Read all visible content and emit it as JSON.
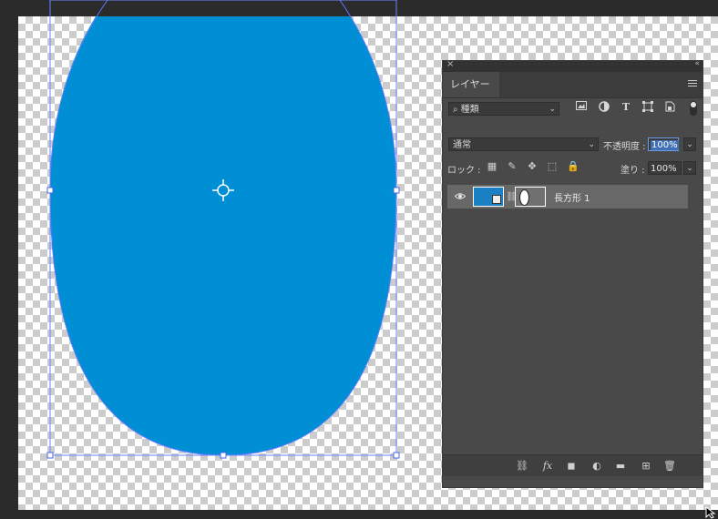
{
  "panel": {
    "tab_label": "レイヤー",
    "filter": {
      "glass": "⌕",
      "value": "種類",
      "chevron": "⌄"
    },
    "filter_icons": [
      "image-filter-icon",
      "adjustment-filter-icon",
      "type-filter-icon",
      "shape-filter-icon",
      "smart-object-filter-icon"
    ],
    "blend_mode": "通常",
    "opacity_label": "不透明度 :",
    "opacity_value": "100%",
    "lock_label": "ロック :",
    "fill_label": "塗り :",
    "fill_value": "100%",
    "layers": [
      {
        "name": "長方形 1",
        "visible": true,
        "fill_color": "#1b7fc4"
      }
    ]
  },
  "canvas": {
    "shape_color": "#008fd5",
    "guide_color": "#5a7bff"
  },
  "glyphs": {
    "close": "×",
    "collapse": "«",
    "eye": "👁",
    "chain": "⛓",
    "dropdown": "⌄",
    "lock_transparent": "▦",
    "lock_paint": "✎",
    "lock_move": "✥",
    "lock_artboard": "⬚",
    "lock_all": "🔒",
    "footer_link": "⛓",
    "footer_fx": "fx",
    "footer_mask": "◼",
    "footer_adjust": "◐",
    "footer_folder": "▬",
    "footer_new": "⊞",
    "footer_trash": "🗑"
  }
}
